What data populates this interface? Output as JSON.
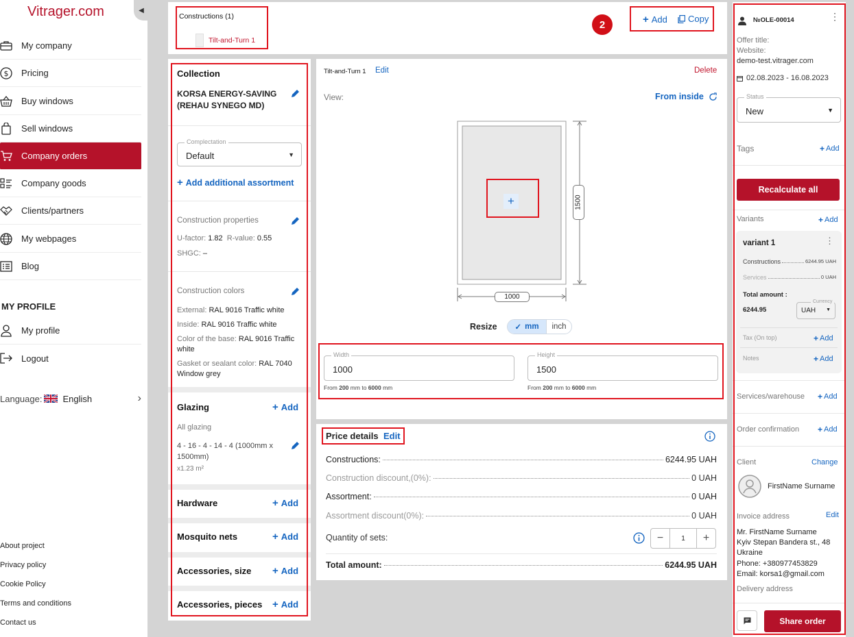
{
  "app": {
    "logo": "Vitrager.com"
  },
  "sidebar": {
    "items": [
      {
        "label": "My company",
        "icon": "briefcase-icon"
      },
      {
        "label": "Pricing",
        "icon": "dollar-icon"
      },
      {
        "label": "Buy windows",
        "icon": "basket-icon"
      },
      {
        "label": "Sell windows",
        "icon": "bag-icon"
      },
      {
        "label": "Company orders",
        "icon": "cart-icon",
        "active": true
      },
      {
        "label": "Company goods",
        "icon": "list-icon"
      },
      {
        "label": "Clients/partners",
        "icon": "handshake-icon"
      },
      {
        "label": "My webpages",
        "icon": "globe-icon"
      },
      {
        "label": "Blog",
        "icon": "blog-icon"
      }
    ],
    "profile_heading": "MY PROFILE",
    "profile_items": [
      {
        "label": "My profile",
        "icon": "user-icon"
      },
      {
        "label": "Logout",
        "icon": "logout-icon"
      }
    ],
    "language_label": "Language:",
    "language_value": "English",
    "footer_links": [
      "About project",
      "Privacy policy",
      "Cookie Policy",
      "Terms and conditions",
      "Contact us"
    ]
  },
  "constructions": {
    "title": "Constructions (1)",
    "item": "Tilt-and-Turn 1",
    "badge": "2",
    "add_label": "Add",
    "copy_label": "Copy"
  },
  "collection": {
    "heading": "Collection",
    "name": "KORSA ENERGY-SAVING (REHAU SYNEGO MD)",
    "complectation_label": "Complectation",
    "complectation_value": "Default",
    "add_assortment": "Add additional assortment",
    "properties_heading": "Construction properties",
    "u_factor_label": "U-factor:",
    "u_factor": "1.82",
    "r_value_label": "R-value:",
    "r_value": "0.55",
    "shgc_label": "SHGC:",
    "shgc": "–",
    "colors_heading": "Construction colors",
    "external_label": "External:",
    "external": "RAL 9016 Traffic white",
    "inside_label": "Inside:",
    "inside": "RAL 9016 Traffic white",
    "base_label": "Color of the base:",
    "base": "RAL 9016 Traffic white",
    "gasket_label": "Gasket or sealant color:",
    "gasket": "RAL 7040 Window grey",
    "glazing_heading": "Glazing",
    "glazing_sub": "All glazing",
    "glazing_spec": "4 - 16 - 4 - 14 - 4 (1000mm x 1500mm)",
    "glazing_area": "x1.23 m²",
    "hardware": "Hardware",
    "mosquito": "Mosquito nets",
    "acc_size": "Accessories, size",
    "acc_pieces": "Accessories, pieces",
    "add_label": "Add"
  },
  "construction": {
    "name": "Tilt-and-Turn 1",
    "edit_label": "Edit",
    "delete_label": "Delete",
    "view_label": "View:",
    "view_value": "From inside",
    "height_dim": "1500",
    "width_dim": "1000",
    "resize_label": "Resize",
    "unit_mm": "mm",
    "unit_inch": "inch",
    "width_label": "Width",
    "width_value": "1000",
    "height_label": "Height",
    "height_value": "1500",
    "range_from": "From",
    "range_to": "to",
    "range_min": "200",
    "range_max": "6000",
    "range_unit": "mm"
  },
  "price": {
    "heading": "Price details",
    "edit_label": "Edit",
    "rows": [
      {
        "label": "Constructions:",
        "value": "6244.95 UAH",
        "muted": false
      },
      {
        "label": "Construction discount,(0%):",
        "value": "0 UAH",
        "muted": true
      },
      {
        "label": "Assortment:",
        "value": "0 UAH",
        "muted": false
      },
      {
        "label": "Assortment discount(0%):",
        "value": "0 UAH",
        "muted": true
      }
    ],
    "quantity_label": "Quantity of sets:",
    "quantity": "1",
    "total_label": "Total amount:",
    "total_value": "6244.95 UAH"
  },
  "order": {
    "number": "№OLE-00014",
    "offer_title_label": "Offer title:",
    "website_label": "Website:",
    "website": "demo-test.vitrager.com",
    "dates": "02.08.2023 - 16.08.2023",
    "status_label": "Status",
    "status_value": "New",
    "tags_label": "Tags",
    "add_label": "Add",
    "recalculate": "Recalculate all",
    "variants_label": "Variants",
    "variant_name": "variant 1",
    "v_constructions_label": "Constructions",
    "v_constructions": "6244.95 UAH",
    "v_services_label": "Services",
    "v_services": "0 UAH",
    "v_total_label": "Total amount :",
    "v_total": "6244.95",
    "currency_label": "Currency",
    "currency": "UAH",
    "tax_label": "Tax (On top)",
    "notes_label": "Notes",
    "services_label": "Services/warehouse",
    "confirmation_label": "Order confirmation",
    "client_label": "Client",
    "change_label": "Change",
    "client_name": "FirstName Surname",
    "invoice_label": "Invoice address",
    "edit_label": "Edit",
    "addr_name": "Mr. FirstName Surname",
    "addr_street": "Kyiv Stepan Bandera st., 48",
    "addr_country": "Ukraine",
    "addr_phone": "Phone: +380977453829",
    "addr_email": "Email: korsa1@gmail.com",
    "delivery_label": "Delivery address",
    "share_label": "Share order"
  }
}
